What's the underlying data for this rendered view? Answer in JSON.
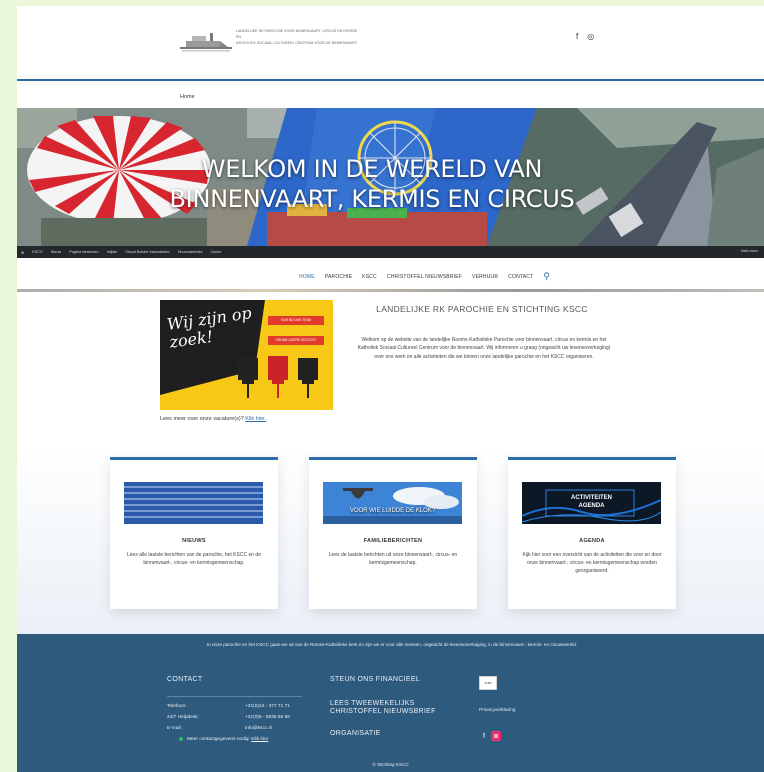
{
  "header": {
    "logo_lines": [
      "LANDELIJKE RK PAROCHIE VOOR BINNENVAART, CIRCUS EN KERMIS",
      "EN",
      "KATHOLIEK SOCIAAL CULTUREEL CENTRUM VOOR DE BINNENVAART"
    ],
    "facebook_glyph": "f",
    "instagram_glyph": "◎"
  },
  "breadcrumb": {
    "home": "Home"
  },
  "hero": {
    "title_line1": "WELKOM IN DE WERELD VAN",
    "title_line2": "BINNENVAART, KERMIS EN CIRCUS"
  },
  "admin_bar": {
    "items": [
      "KSCC",
      "Nieuw",
      "Pagina bewerken",
      "Inlijste",
      "Visual Builder inschakelen",
      "Duurzaamheid",
      "Cache"
    ],
    "right": "Hallo kscc"
  },
  "nav": {
    "items": [
      "HOME",
      "PAROCHIE",
      "KSCC",
      "CHRISTOFFEL NIEUWSBRIEF",
      "VERHUUR",
      "CONTACT"
    ],
    "search_glyph": "⚲"
  },
  "intro": {
    "vacancy_text_line1": "Wij zijn op",
    "vacancy_text_line2": "zoek!",
    "vacancy_tag1": "KOM BIJ ONS TEAM",
    "vacancy_tag2": "VRIJWILLIGERS GEZOCHT",
    "vacancy_link_prefix": "Lees meer over onze vacature(s)?",
    "vacancy_link_text": "Klik hier.",
    "title": "LANDELIJKE RK PAROCHIE EN STICHTING KSCC",
    "body": "Welkom op de website van de landelijke Rooms-Katholieke Parochie voor binnenvaart, circus en kermis en het Katholiek Sociaal Cultureel Centrum voor de binnenvaart. Wij informeren u graag (ongeacht uw levensovertuiging) over ons werk en alle activiteiten die we binnen onze landelijke parochie en het KSCC organiseren."
  },
  "cards": [
    {
      "title": "NIEUWS",
      "text": "Lees alle laatste berichten van de parochie, het KSCC en de binnenvaart-, circus- en kermisgemeenschap."
    },
    {
      "title": "FAMILIEBERICHTEN",
      "image_caption": "VOOR WIE LUIDDE DE KLOK?",
      "text": "Lees de laatste berichten uit onze binnenvaart-, circus- en kermisgemeenschap."
    },
    {
      "title": "AGENDA",
      "image_caption_line1": "ACTIVITEITEN",
      "image_caption_line2": "AGENDA",
      "text": "Kijk hier voor een overzicht van de activiteiten die voor en door onze binnenvaart-, circus- en kermisgemeenschap worden georganiseerd."
    }
  ],
  "footer": {
    "intro": "In onze parochie en het KSCC gaan we uit van de Rooms-Katholieke kerk en zijn we er voor alle mensen, ongeacht de levensovertuiging, in de binnenvaart-, kermis- en circuswereld.",
    "contact_heading": "CONTACT",
    "rows": [
      {
        "label": "Telefoon:",
        "value": "+31(0)24 - 377 71 71"
      },
      {
        "label": "24/7 Helpdesk:",
        "value": "+31(0)6 - 5535 66 66"
      },
      {
        "label": "E-mail:",
        "value": "info@kscc.nl"
      }
    ],
    "contact_more_prefix": "Meer contactgegevens nodig:",
    "contact_more_link": "Klik hier",
    "support_heading": "STEUN ONS FINANCIEEL",
    "newsletter_heading_line1": "LEES TWEEWEKELIJKS",
    "newsletter_heading_line2": "CHRISTOFFEL NIEUWSBRIEF",
    "organisation_heading": "ORGANISATIE",
    "anbi_label": "ANBI",
    "privacy": "Privacyverklaring",
    "copyright": "© Stichting KSCC"
  },
  "colors": {
    "accent": "#2e6ea8",
    "footer_bg": "#2e5a7e",
    "outer_bg": "#eaf7d9",
    "vacancy_bg": "#f7c815"
  }
}
